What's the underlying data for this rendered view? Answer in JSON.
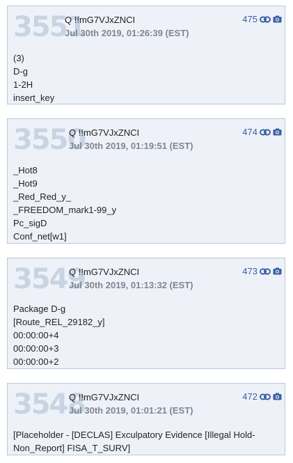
{
  "posts": [
    {
      "number": "3551",
      "author": "Q !!mG7VJxZNCI",
      "timestamp": "Jul 30th 2019, 01:26:39 (EST)",
      "count": "475",
      "lines": [
        "(3)",
        "D-g",
        "1-2H",
        "insert_key"
      ]
    },
    {
      "number": "3550",
      "author": "Q !!mG7VJxZNCI",
      "timestamp": "Jul 30th 2019, 01:19:51 (EST)",
      "count": "474",
      "lines": [
        "_Hot8",
        "_Hot9",
        "_Red_Red_y_",
        "_FREEDOM_mark1-99_y",
        "Pc_sigD",
        "Conf_net[w1]"
      ]
    },
    {
      "number": "3549",
      "author": "Q !!mG7VJxZNCI",
      "timestamp": "Jul 30th 2019, 01:13:32 (EST)",
      "count": "473",
      "lines": [
        "Package D-g",
        "[Route_REL_29182_y]",
        "00:00:00+4",
        "00:00:00+3",
        "00:00:00+2"
      ]
    },
    {
      "number": "3548",
      "author": "Q !!mG7VJxZNCI",
      "timestamp": "Jul 30th 2019, 01:01:21 (EST)",
      "count": "472",
      "lines": [
        "[Placeholder - [DECLAS] Exculpatory Evidence [Illegal Hold-Non_Report] FISA_T_SURV]"
      ]
    }
  ],
  "icons": {
    "link": "chain-link-icon",
    "camera": "camera-icon"
  },
  "colors": {
    "accent": "#3a5fa8",
    "card_bg": "#eef2f8",
    "card_border": "#b9c7d8",
    "post_number": "#c9d4e2",
    "timestamp": "#7e8692"
  }
}
